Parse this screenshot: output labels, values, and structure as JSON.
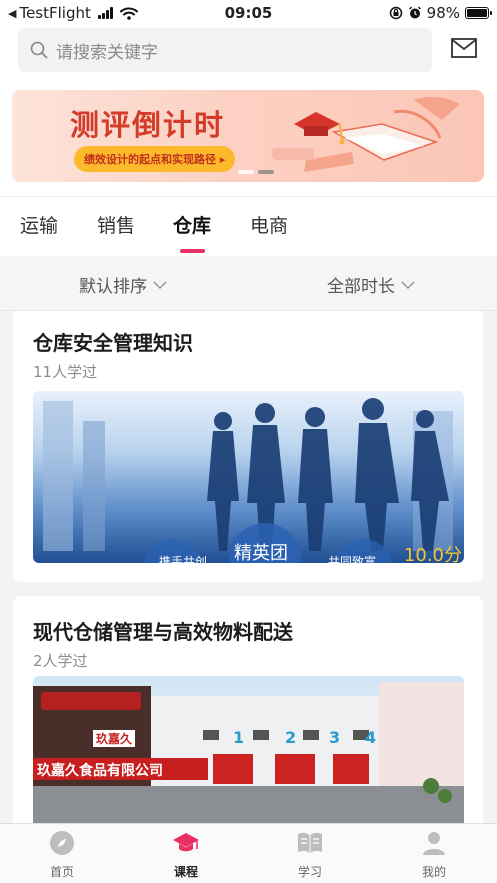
{
  "status_bar": {
    "back_app": "TestFlight",
    "time": "09:05",
    "battery": "98%",
    "battery_level": 0.98
  },
  "search": {
    "placeholder": "请搜索关键字"
  },
  "banner": {
    "title": "测评倒计时",
    "pill": "绩效设计的起点和实现路径 ▸",
    "active_slide": 2,
    "slide_count": 2
  },
  "tabs": [
    {
      "label": "运输"
    },
    {
      "label": "销售"
    },
    {
      "label": "仓库"
    },
    {
      "label": "电商"
    }
  ],
  "active_tab": "仓库",
  "filters": {
    "sort": "默认排序",
    "duration": "全部时长"
  },
  "courses": [
    {
      "title": "仓库安全管理知识",
      "learners": "11人学过",
      "image_texts": {
        "badge": "精英团",
        "duration": "10.0分",
        "left": "携手共创",
        "right": "共同致富"
      }
    },
    {
      "title": "现代仓储管理与高效物料配送",
      "learners": "2人学过",
      "image_texts": {
        "company": "玖嘉久食品有限公司",
        "logo": "玖嘉久",
        "dock_numbers": [
          "1",
          "2",
          "3",
          "4"
        ]
      }
    }
  ],
  "bottom_nav": [
    {
      "label": "首页",
      "icon": "compass-icon"
    },
    {
      "label": "课程",
      "icon": "graduation-cap-icon"
    },
    {
      "label": "学习",
      "icon": "book-icon"
    },
    {
      "label": "我的",
      "icon": "user-icon"
    }
  ],
  "colors": {
    "accent": "#e83063",
    "banner_title": "#d43c2a",
    "banner_pill": "#fcb92c"
  }
}
